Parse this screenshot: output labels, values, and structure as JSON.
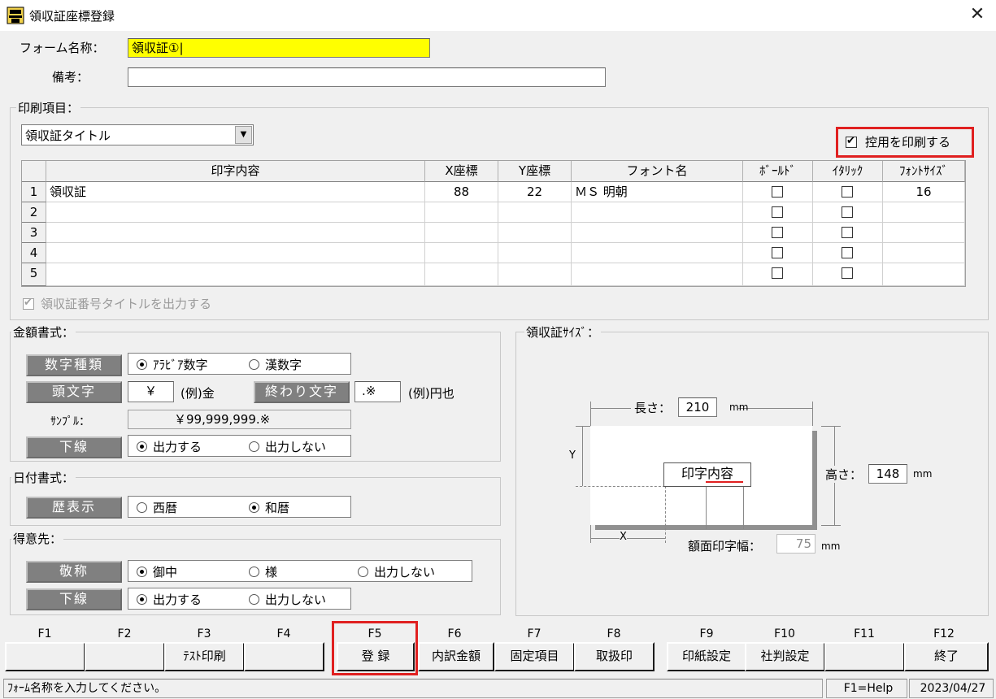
{
  "window": {
    "title": "領収証座標登録",
    "close_glyph": "✕",
    "icon": "printer-register-icon"
  },
  "form": {
    "name_label": "フォーム名称：",
    "name_value": "領収証①|",
    "memo_label": "備考：",
    "memo_value": ""
  },
  "print_items": {
    "group_title": "印刷項目：",
    "selected": "領収証タイトル",
    "print_copy_label": "控用を印刷する",
    "print_copy_checked": true,
    "columns": [
      "印字内容",
      "X座標",
      "Y座標",
      "フォント名",
      "ﾎﾞｰﾙﾄﾞ",
      "ｲﾀﾘｯｸ",
      "ﾌｫﾝﾄｻｲｽﾞ"
    ],
    "rows": [
      {
        "no": "1",
        "content": "領収証",
        "x": "88",
        "y": "22",
        "font": "ＭＳ 明朝",
        "bold": false,
        "italic": false,
        "size": "16"
      },
      {
        "no": "2",
        "content": "",
        "x": "",
        "y": "",
        "font": "",
        "bold": false,
        "italic": false,
        "size": ""
      },
      {
        "no": "3",
        "content": "",
        "x": "",
        "y": "",
        "font": "",
        "bold": false,
        "italic": false,
        "size": ""
      },
      {
        "no": "4",
        "content": "",
        "x": "",
        "y": "",
        "font": "",
        "bold": false,
        "italic": false,
        "size": ""
      },
      {
        "no": "5",
        "content": "",
        "x": "",
        "y": "",
        "font": "",
        "bold": false,
        "italic": false,
        "size": ""
      }
    ],
    "number_title_label": "領収証番号タイトルを出力する",
    "number_title_checked": true
  },
  "amount": {
    "group_title": "金額書式：",
    "digit_type_label": "数字種類",
    "digit_opt1": "ｱﾗﾋﾞｱ数字",
    "digit_opt2": "漢数字",
    "prefix_label": "頭文字",
    "prefix_value": "￥",
    "prefix_example": "(例)金",
    "suffix_label": "終わり文字",
    "suffix_value": ".※",
    "suffix_example": "(例)円也",
    "sample_label": "ｻﾝﾌﾟﾙ：",
    "sample_value": "￥99,999,999.※",
    "underline_label": "下線",
    "underline_opt1": "出力する",
    "underline_opt2": "出力しない"
  },
  "date": {
    "group_title": "日付書式：",
    "era_label": "歴表示",
    "era_opt1": "西暦",
    "era_opt2": "和暦"
  },
  "customer": {
    "group_title": "得意先：",
    "honorific_label": "敬称",
    "hon_opt1": "御中",
    "hon_opt2": "様",
    "hon_opt3": "出力しない",
    "underline_label": "下線",
    "underline_opt1": "出力する",
    "underline_opt2": "出力しない"
  },
  "size": {
    "group_title": "領収証ｻｲｽﾞ：",
    "length_label": "長さ：",
    "length_value": "210",
    "length_unit": "mm",
    "height_label": "高さ：",
    "height_value": "148",
    "height_unit": "mm",
    "print_width_label": "額面印字幅：",
    "print_width_value": "75",
    "print_width_unit": "mm",
    "content_label": "印字内容",
    "x_label": "X",
    "y_label": "Y"
  },
  "fkeys": [
    {
      "key": "F1",
      "label": ""
    },
    {
      "key": "F2",
      "label": ""
    },
    {
      "key": "F3",
      "label": "ﾃｽﾄ印刷"
    },
    {
      "key": "F4",
      "label": ""
    },
    {
      "key": "F5",
      "label": "登 録"
    },
    {
      "key": "F6",
      "label": "内訳金額"
    },
    {
      "key": "F7",
      "label": "固定項目"
    },
    {
      "key": "F8",
      "label": "取扱印"
    },
    {
      "key": "F9",
      "label": "印紙設定"
    },
    {
      "key": "F10",
      "label": "社判設定"
    },
    {
      "key": "F11",
      "label": ""
    },
    {
      "key": "F12",
      "label": "終了"
    }
  ],
  "status": {
    "message": "ﾌｫｰﾑ名称を入力してください。",
    "help": "F1=Help",
    "date": "2023/04/27"
  },
  "colors": {
    "highlight_red": "#e02020",
    "name_field_yellow": "#ffff00"
  }
}
